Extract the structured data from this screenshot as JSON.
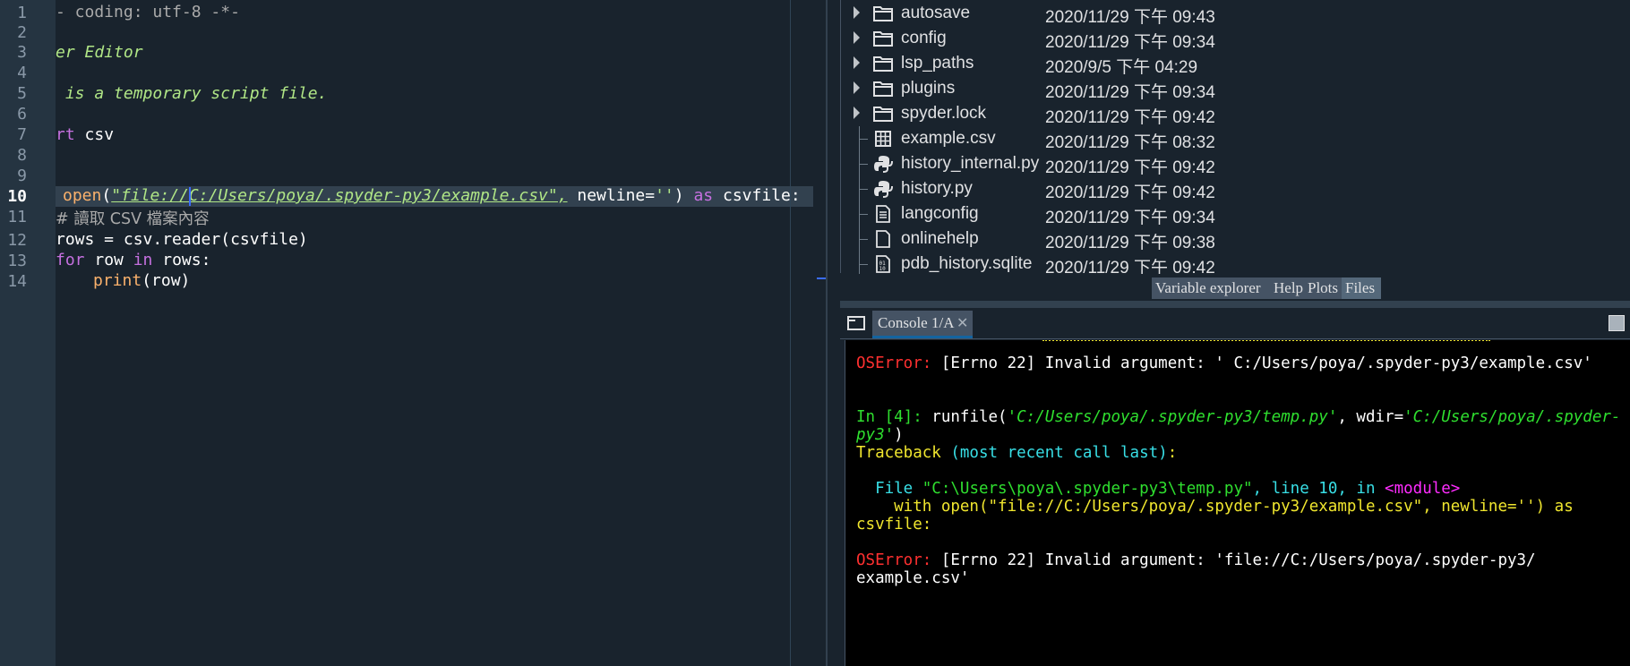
{
  "editor": {
    "line_numbers": [
      "1",
      "2",
      "3",
      "4",
      "5",
      "6",
      "7",
      "8",
      "9",
      "10",
      "11",
      "12",
      "13",
      "14"
    ],
    "current_line": "10",
    "lines": {
      "l1": "- coding: utf-8 -*-",
      "l3": "er Editor",
      "l5": " is a temporary script file.",
      "l7_kw": "rt",
      "l7_rest": " csv",
      "l10_builtin": "open",
      "l10_p1": "(",
      "l10_str": "\"file://C:/Users/poya/.spyder-py3/example.csv\",",
      "l10_mid": " newline=",
      "l10_str2": "''",
      "l10_p2": ")",
      "l10_as": "as",
      "l10_end": " csvfile:",
      "l11": "# 讀取 CSV 檔案內容",
      "l12": "rows = csv.reader(csvfile)",
      "l13_for": "for",
      "l13_mid": " row ",
      "l13_in": "in",
      "l13_end": " rows:",
      "l14_print": "print",
      "l14_end": "(row)"
    }
  },
  "files": {
    "rows": [
      {
        "name": "autosave",
        "date": "2020/11/29 下午 09:43",
        "type": "folder"
      },
      {
        "name": "config",
        "date": "2020/11/29 下午 09:34",
        "type": "folder"
      },
      {
        "name": "lsp_paths",
        "date": "2020/9/5 下午 04:29",
        "type": "folder"
      },
      {
        "name": "plugins",
        "date": "2020/11/29 下午 09:34",
        "type": "folder"
      },
      {
        "name": "spyder.lock",
        "date": "2020/11/29 下午 09:42",
        "type": "folder"
      },
      {
        "name": "example.csv",
        "date": "2020/11/29 下午 08:32",
        "type": "csv"
      },
      {
        "name": "history_internal.py",
        "date": "2020/11/29 下午 09:42",
        "type": "python"
      },
      {
        "name": "history.py",
        "date": "2020/11/29 下午 09:42",
        "type": "python"
      },
      {
        "name": "langconfig",
        "date": "2020/11/29 下午 09:34",
        "type": "text"
      },
      {
        "name": "onlinehelp",
        "date": "2020/11/29 下午 09:38",
        "type": "text"
      },
      {
        "name": "pdb_history.sqlite",
        "date": "2020/11/29 下午 09:42",
        "type": "binary"
      }
    ]
  },
  "pane_tabs": {
    "variable_explorer": "Variable explorer",
    "help": "Help",
    "plots": "Plots",
    "files": "Files"
  },
  "console": {
    "tab_label": "Console 1/A",
    "l1_err": "OSError:",
    "l1_rest": " [Errno 22] Invalid argument: ' C:/Users/poya/.spyder-py3/example.csv'",
    "l2_prompt": "In [4]:",
    "l2_a": " runfile(",
    "l2_b": "'C:/Users/poya/.spyder-py3/temp.py'",
    "l2_c": ", wdir=",
    "l2_d": "'C:/Users/poya/.spyder-",
    "l3_a": "py3'",
    "l3_b": ")",
    "l4_a": "Traceback ",
    "l4_b": "(most recent call last)",
    "l4_c": ":",
    "l5_a": "  File ",
    "l5_b": "\"C:\\Users\\poya\\.spyder-py3\\temp.py\"",
    "l5_c": ", line 10, in ",
    "l5_d": "<module>",
    "l6": "    with open(\"file://C:/Users/poya/.spyder-py3/example.csv\", newline='') as",
    "l7": "csvfile:",
    "l8_err": "OSError:",
    "l8_rest": " [Errno 22] Invalid argument: 'file://C:/Users/poya/.spyder-py3/",
    "l9": "example.csv'"
  }
}
